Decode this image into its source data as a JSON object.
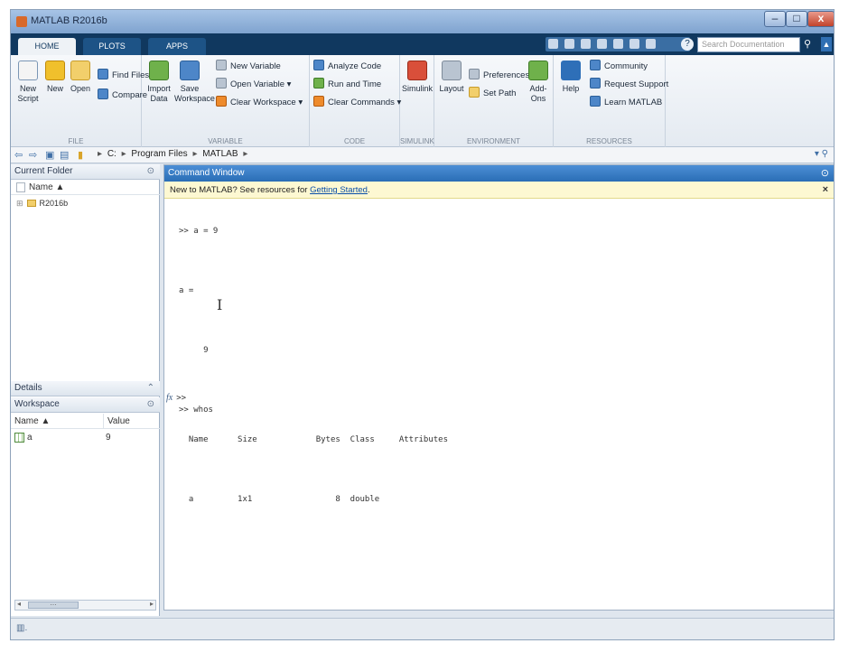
{
  "window": {
    "title": "MATLAB R2016b",
    "controls": {
      "minimize": "–",
      "maximize": "□",
      "close": "x"
    }
  },
  "tabs": [
    "HOME",
    "PLOTS",
    "APPS"
  ],
  "search": {
    "placeholder": "Search Documentation"
  },
  "ribbon": {
    "file": {
      "label": "FILE",
      "new_script": "New Script",
      "new": "New",
      "open": "Open",
      "find_files": "Find Files",
      "compare": "Compare"
    },
    "variable": {
      "label": "VARIABLE",
      "import_data": "Import Data",
      "save_workspace": "Save Workspace",
      "new_variable": "New Variable",
      "open_variable": "Open Variable ▾",
      "clear_workspace": "Clear Workspace ▾"
    },
    "code": {
      "label": "CODE",
      "analyze_code": "Analyze Code",
      "run_and_time": "Run and Time",
      "clear_commands": "Clear Commands ▾"
    },
    "simulink": {
      "label": "SIMULINK",
      "simulink": "Simulink"
    },
    "environment": {
      "label": "ENVIRONMENT",
      "layout": "Layout",
      "preferences": "Preferences",
      "set_path": "Set Path",
      "add_ons": "Add-Ons"
    },
    "resources": {
      "label": "RESOURCES",
      "help": "Help",
      "community": "Community",
      "request_support": "Request Support",
      "learn_matlab": "Learn MATLAB"
    }
  },
  "address": {
    "path": [
      "C:",
      "Program Files",
      "MATLAB"
    ]
  },
  "current_folder": {
    "title": "Current Folder",
    "column": "Name ▲",
    "items": [
      "R2016b"
    ]
  },
  "details": {
    "title": "Details"
  },
  "workspace": {
    "title": "Workspace",
    "columns": [
      "Name ▲",
      "Value"
    ],
    "rows": [
      {
        "name": "a",
        "value": "9"
      }
    ]
  },
  "command_window": {
    "title": "Command Window",
    "info_text": "New to MATLAB? See resources for ",
    "info_link": "Getting Started",
    "info_period": ".",
    "lines": [
      ">> a = 9",
      "",
      "a =",
      "",
      "     9",
      "",
      ">> whos",
      "  Name      Size            Bytes  Class     Attributes",
      "",
      "  a         1x1                 8  double",
      ""
    ],
    "prompt_symbol": "fx",
    "prompt": ">>"
  }
}
